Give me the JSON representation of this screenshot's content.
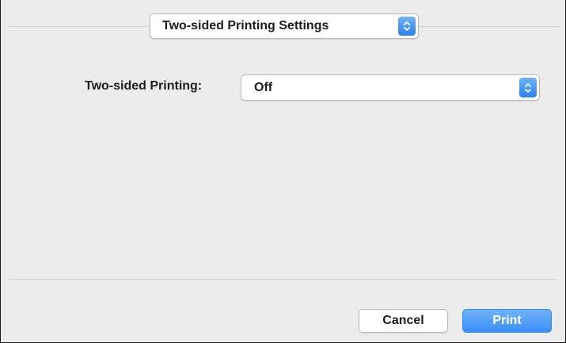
{
  "panel_selector": {
    "selected": "Two-sided Printing Settings"
  },
  "duplex": {
    "label": "Two-sided Printing:",
    "selected": "Off"
  },
  "buttons": {
    "cancel": "Cancel",
    "print": "Print"
  },
  "icons": {
    "popup_stepper": "up-down-chevron-icon"
  },
  "colors": {
    "accent": "#3a8ef3",
    "dialog_background": "#ececec"
  }
}
